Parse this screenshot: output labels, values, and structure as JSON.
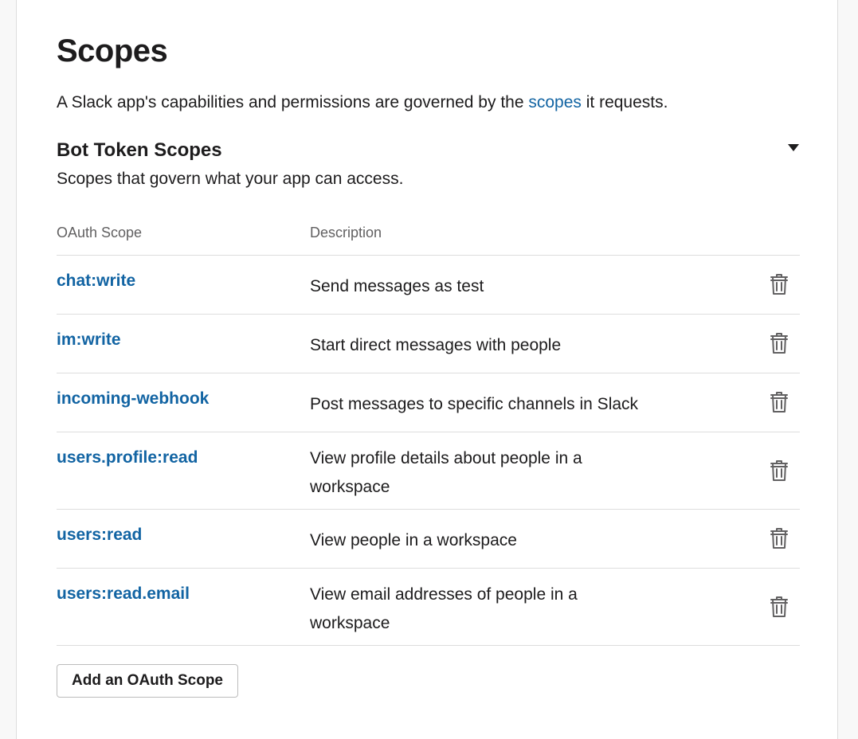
{
  "page": {
    "title": "Scopes",
    "intro_before": "A Slack app's capabilities and permissions are governed by the ",
    "intro_link": "scopes",
    "intro_after": " it requests."
  },
  "section": {
    "title": "Bot Token Scopes",
    "subtitle": "Scopes that govern what your app can access.",
    "collapse_icon": "caret-down-icon"
  },
  "table": {
    "headers": {
      "scope": "OAuth Scope",
      "description": "Description"
    },
    "rows": [
      {
        "scope": "chat:write",
        "description": "Send messages as test",
        "action_icon": "trash-icon"
      },
      {
        "scope": "im:write",
        "description": "Start direct messages with people",
        "action_icon": "trash-icon"
      },
      {
        "scope": "incoming-webhook",
        "description": "Post messages to specific channels in Slack",
        "action_icon": "trash-icon"
      },
      {
        "scope": "users.profile:read",
        "description": "View profile details about people in a workspace",
        "action_icon": "trash-icon"
      },
      {
        "scope": "users:read",
        "description": "View people in a workspace",
        "action_icon": "trash-icon"
      },
      {
        "scope": "users:read.email",
        "description": "View email addresses of people in a workspace",
        "action_icon": "trash-icon"
      }
    ]
  },
  "add_button": {
    "label": "Add an OAuth Scope"
  },
  "colors": {
    "link": "#1264a3",
    "text": "#1d1c1d",
    "muted": "#616061",
    "divider": "#dddddd"
  }
}
